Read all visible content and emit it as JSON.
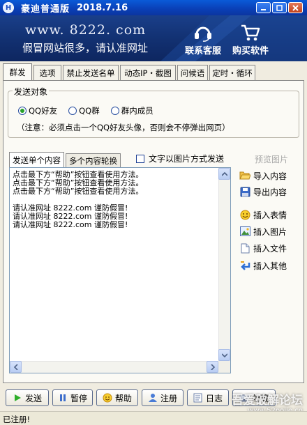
{
  "window": {
    "title": "豪迪普通版",
    "version": "2018.7.16",
    "icon_glyph": "H"
  },
  "banner": {
    "url": "www. 8222. com",
    "slogan": "假冒网站很多，请认准网址",
    "service_label": "联系客服",
    "buy_label": "购买软件"
  },
  "tabs": [
    "群发",
    "选项",
    "禁止发送名单",
    "动态IP・截图",
    "问候语",
    "定时・循环"
  ],
  "send_target": {
    "title": "发送对象",
    "options": [
      "QQ好友",
      "QQ群",
      "群内成员"
    ],
    "selected": "QQ好友",
    "notice": "（注意：必须点击一个QQ好友头像，否则会不停弹出网页）"
  },
  "content_tabs": [
    "发送单个内容",
    "多个内容轮换"
  ],
  "image_mode_label": "文字以图片方式发送",
  "preview_label": "预览图片",
  "editor_text": "点击最下方“帮助”按钮查看使用方法。\n点击最下方“帮助”按钮查看使用方法。\n点击最下方“帮助”按钮查看使用方法。\n\n请认准网址 8222.com 谨防假冒!\n请认准网址 8222.com 谨防假冒!\n请认准网址 8222.com 谨防假冒!",
  "side_buttons": {
    "import": "导入内容",
    "export": "导出内容",
    "emoji": "插入表情",
    "image": "插入图片",
    "file": "插入文件",
    "other": "插入其他"
  },
  "bottom_buttons": {
    "send": "发送",
    "pause": "暂停",
    "help": "帮助",
    "register": "注册",
    "log": "日志",
    "hide": "隐藏"
  },
  "status": "已注册!",
  "watermark": {
    "main": "吾爱破解论坛",
    "sub": "www.52pojie.cn"
  },
  "colors": {
    "titlebar": "#0a3fb5",
    "banner": "#123172",
    "radio_selected": "#27a02a"
  }
}
